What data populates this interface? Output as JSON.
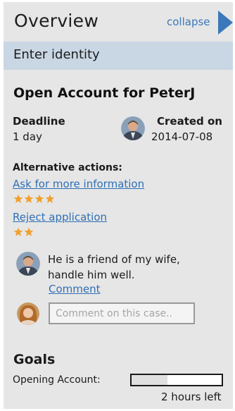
{
  "header": {
    "title": "Overview",
    "collapse_label": "collapse",
    "collapse_icon": "triangle-right-icon",
    "accent": "#3a78b9"
  },
  "step": {
    "label": "Enter identity",
    "background": "#c9d6e4"
  },
  "case": {
    "title": "Open Account for PeterJ",
    "deadline_label": "Deadline",
    "deadline_value": "1 day",
    "created_label": "Created on",
    "created_value": "2014-07-08"
  },
  "alternatives": {
    "label": "Alternative actions:",
    "items": [
      {
        "label": "Ask for more information",
        "rating": 4,
        "max_rating": 4
      },
      {
        "label": "Reject application",
        "rating": 2,
        "max_rating": 2
      }
    ],
    "star_color": "#f0a030"
  },
  "note": {
    "text": "He is a friend of my wife, handle him well.",
    "comment_link": "Comment"
  },
  "comment": {
    "placeholder": "Comment on this case.."
  },
  "goals": {
    "label": "Goals",
    "items": [
      {
        "label": "Opening Account:",
        "progress": 0.4,
        "time_left": "2 hours left"
      }
    ]
  }
}
